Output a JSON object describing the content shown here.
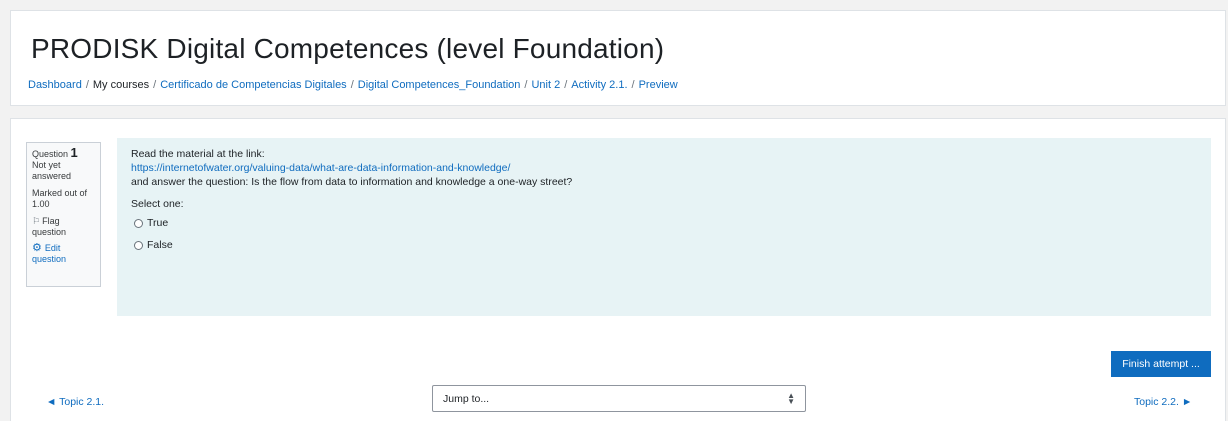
{
  "header": {
    "title": "PRODISK Digital Competences (level Foundation)",
    "breadcrumb": [
      {
        "label": "Dashboard",
        "link": true
      },
      {
        "label": "My courses",
        "link": false
      },
      {
        "label": "Certificado de Competencias Digitales",
        "link": true
      },
      {
        "label": "Digital Competences_Foundation",
        "link": true
      },
      {
        "label": "Unit 2",
        "link": true
      },
      {
        "label": "Activity 2.1.",
        "link": true
      },
      {
        "label": "Preview",
        "link": true
      }
    ],
    "separator": "/"
  },
  "question_info": {
    "question_label": "Question",
    "question_number": "1",
    "state": "Not yet answered",
    "marked": "Marked out of 1.00",
    "flag_label": "Flag question",
    "edit_label": "Edit question"
  },
  "question": {
    "intro": "Read the material at the link:",
    "link": "https://internetofwater.org/valuing-data/what-are-data-information-and-knowledge/",
    "text": "and answer the question: Is the flow from data to information and knowledge a one-way street?",
    "prompt": "Select one:",
    "options": [
      "True",
      "False"
    ]
  },
  "navigation": {
    "finish_label": "Finish attempt ...",
    "prev_label": "◄ Topic 2.1.",
    "next_label": "Topic 2.2. ►",
    "jump_label": "Jump to..."
  },
  "colors": {
    "accent": "#0f6cbf",
    "question_bg": "#e7f3f5",
    "page_bg": "#f2f2f2"
  }
}
